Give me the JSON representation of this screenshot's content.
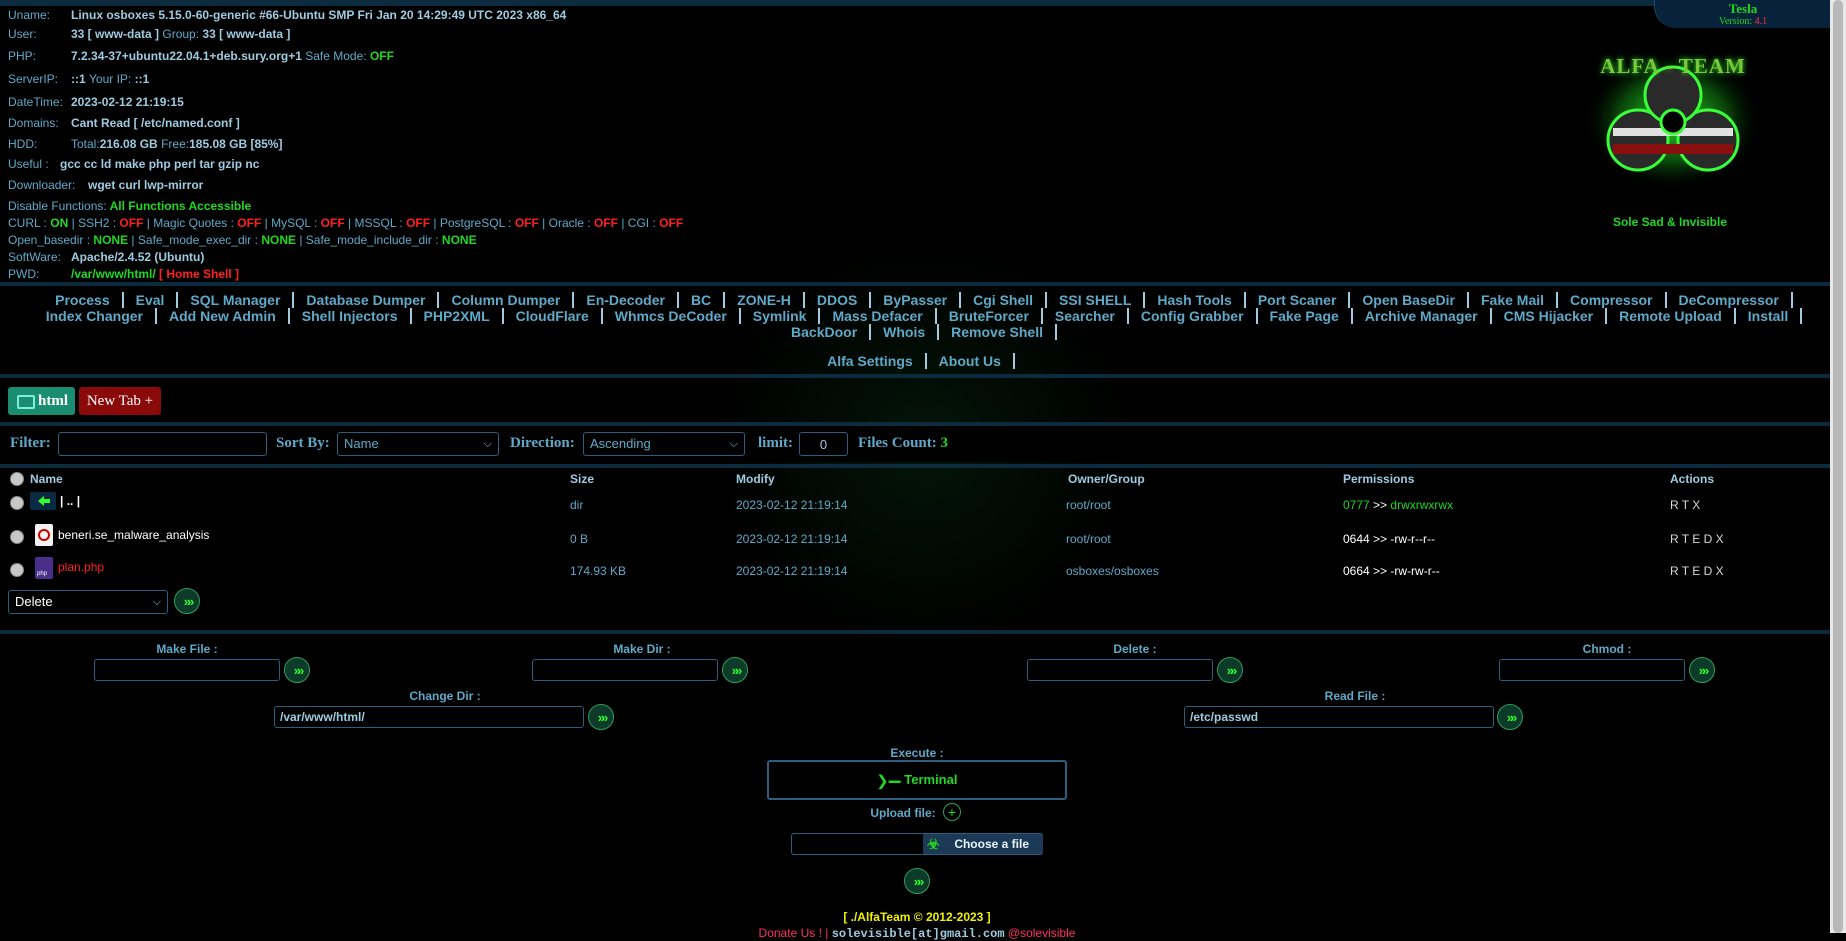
{
  "sysinfo": {
    "uname_label": "Uname:",
    "uname": "Linux osboxes 5.15.0-60-generic #66-Ubuntu SMP Fri Jan 20 14:29:49 UTC 2023 x86_64",
    "user_label": "User:",
    "user": "33 [ www-data ]",
    "group_label": "Group:",
    "group": "33 [ www-data ]",
    "php_label": "PHP:",
    "php": "7.2.34-37+ubuntu22.04.1+deb.sury.org+1",
    "safe_mode_label": "Safe Mode:",
    "safe_mode": "OFF",
    "serverip_label": "ServerIP:",
    "serverip": "::1",
    "yourip_label": "Your IP:",
    "yourip": "::1",
    "datetime_label": "DateTime:",
    "datetime": "2023-02-12 21:19:15",
    "domains_label": "Domains:",
    "domains": "Cant Read [ /etc/named.conf ]",
    "hdd_label": "HDD:",
    "hdd_total_label": "Total:",
    "hdd_total": "216.08 GB",
    "hdd_free_label": "Free:",
    "hdd_free": "185.08 GB [85%]",
    "useful_label": "Useful :",
    "useful": "gcc cc ld make php perl tar gzip nc",
    "downloader_label": "Downloader:",
    "downloader": "wget curl lwp-mirror",
    "disable_label": "Disable Functions:",
    "disable": "All Functions Accessible",
    "curl_label": "CURL :",
    "curl": "ON",
    "ssh2_label": "SSH2 :",
    "ssh2": "OFF",
    "magic_label": "Magic Quotes :",
    "magic": "OFF",
    "mysql_label": "MySQL :",
    "mysql": "OFF",
    "mssql_label": "MSSQL :",
    "mssql": "OFF",
    "pgsql_label": "PostgreSQL :",
    "pgsql": "OFF",
    "oracle_label": "Oracle :",
    "oracle": "OFF",
    "cgi_label": "CGI :",
    "cgi": "OFF",
    "openbasedir_label": "Open_basedir :",
    "openbasedir": "NONE",
    "safeexec_label": "Safe_mode_exec_dir :",
    "safeexec": "NONE",
    "safeinclude_label": "Safe_mode_include_dir :",
    "safeinclude": "NONE",
    "software_label": "SoftWare:",
    "software": "Apache/2.4.52 (Ubuntu)",
    "pwd_label": "PWD:",
    "pwd": "/var/www/html/",
    "home_shell": "[ Home Shell ]"
  },
  "brand": {
    "name": "Tesla",
    "version_label": "Version:",
    "version": "4.1",
    "logo_text": "ALFA - TEAM",
    "tagline": "Sole Sad & Invisible"
  },
  "menu": {
    "row1": [
      "Process",
      "Eval",
      "SQL Manager",
      "Database Dumper",
      "Column Dumper",
      "En-Decoder",
      "BC",
      "ZONE-H",
      "DDOS",
      "ByPasser",
      "Cgi Shell",
      "SSI SHELL",
      "Hash Tools",
      "Port Scaner",
      "Open BaseDir",
      "Fake Mail",
      "Compressor",
      "DeCompressor"
    ],
    "row2": [
      "Index Changer",
      "Add New Admin",
      "Shell Injectors",
      "PHP2XML",
      "CloudFlare",
      "Whmcs DeCoder",
      "Symlink",
      "Mass Defacer",
      "BruteForcer",
      "Searcher",
      "Config Grabber",
      "Fake Page",
      "Archive Manager",
      "CMS Hijacker",
      "Remote Upload",
      "Install"
    ],
    "row3": [
      "BackDoor",
      "Whois",
      "Remove Shell"
    ],
    "row4": [
      "Alfa Settings",
      "About Us"
    ]
  },
  "tabs": {
    "current": "html",
    "new_tab": "New Tab +"
  },
  "filterbar": {
    "filter_label": "Filter:",
    "filter_value": "",
    "sortby_label": "Sort By:",
    "sortby_value": "Name",
    "direction_label": "Direction:",
    "direction_value": "Ascending",
    "limit_label": "limit:",
    "limit_value": "0",
    "count_label": "Files Count:",
    "count_value": "3"
  },
  "table": {
    "headers": [
      "Name",
      "Size",
      "Modify",
      "Owner/Group",
      "Permissions",
      "Actions"
    ],
    "rows": [
      {
        "name": "| .. |",
        "size": "dir",
        "modify": "2023-02-12 21:19:14",
        "owner": "root/root",
        "perm_oct": "0777",
        "perm_sep": ">>",
        "perm_str": "drwxrwxrwx",
        "actions": "R T X"
      },
      {
        "name": "beneri.se_malware_analysis",
        "size": "0 B",
        "modify": "2023-02-12 21:19:14",
        "owner": "root/root",
        "perm_oct": "0644",
        "perm_sep": ">>",
        "perm_str": "-rw-r--r--",
        "actions": "R T E D X"
      },
      {
        "name": "plan.php",
        "size": "174.93 KB",
        "modify": "2023-02-12 21:19:14",
        "owner": "osboxes/osboxes",
        "perm_oct": "0664",
        "perm_sep": ">>",
        "perm_str": "-rw-rw-r--",
        "actions": "R T E D X"
      }
    ],
    "bulk_action": "Delete"
  },
  "tools": {
    "make_file_label": "Make File :",
    "make_dir_label": "Make Dir :",
    "delete_label": "Delete :",
    "chmod_label": "Chmod :",
    "change_dir_label": "Change Dir :",
    "change_dir_value": "/var/www/html/",
    "read_file_label": "Read File :",
    "read_file_value": "/etc/passwd",
    "execute_label": "Execute :",
    "terminal_label": "Terminal",
    "upload_label": "Upload file:",
    "choose_file": "Choose a file"
  },
  "footer": {
    "copyright": "[ ./AlfaTeam © 2012-2023 ]",
    "donate": "Donate Us !",
    "email": "solevisible[at]gmail.com",
    "handle": "@solevisible"
  },
  "colors": {
    "accent": "#63a4c4",
    "on": "#1fd81f",
    "off": "#ff2020",
    "panel_border": "#0d2b3e"
  }
}
